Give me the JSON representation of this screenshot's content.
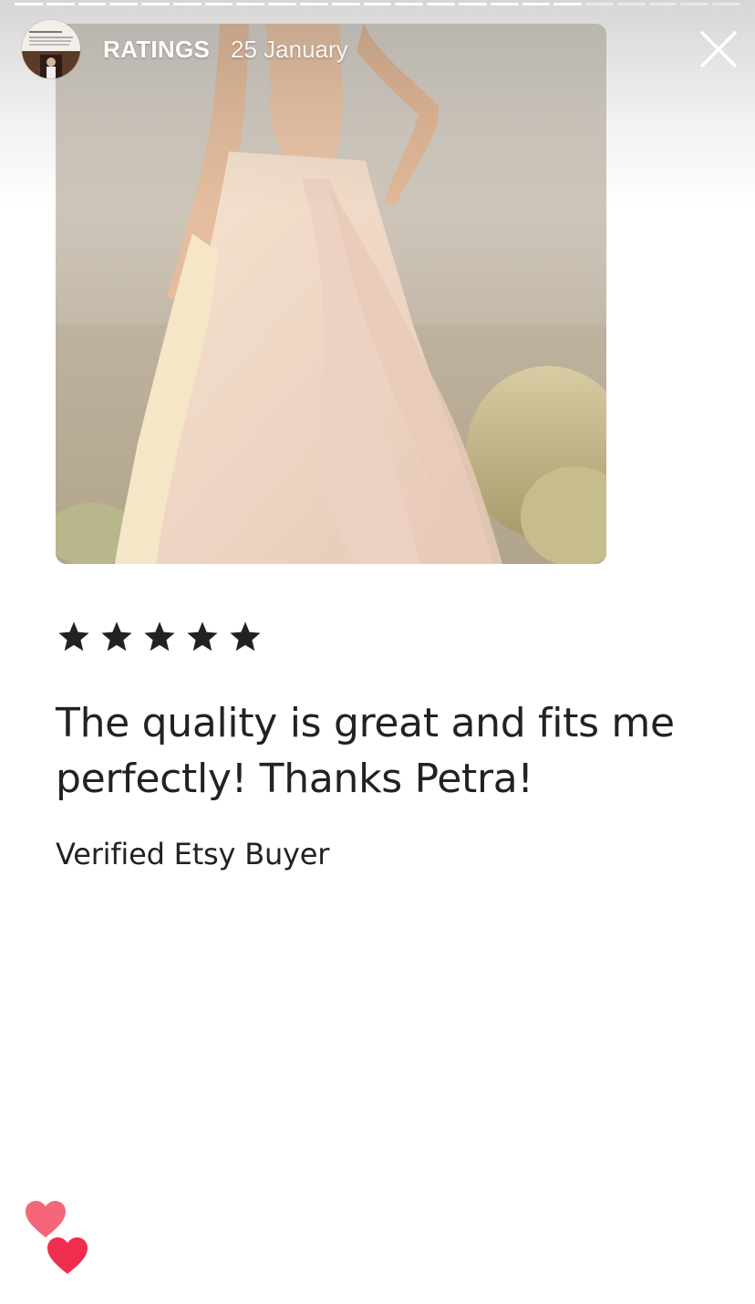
{
  "story": {
    "segments_total": 23,
    "segments_viewed": 18
  },
  "header": {
    "username": "RATINGS",
    "date": "25 January"
  },
  "review": {
    "rating": 5,
    "max_rating": 5,
    "text": "The quality is great and fits me perfectly! Thanks Petra!",
    "reviewer": "Verified Etsy Buyer"
  },
  "icons": {
    "close": "close-icon",
    "star": "star-icon",
    "heart": "heart-icon"
  },
  "colors": {
    "star": "#222222",
    "text": "#222222",
    "heart_light": "#f4667a",
    "heart_dark": "#ef2d4f"
  }
}
